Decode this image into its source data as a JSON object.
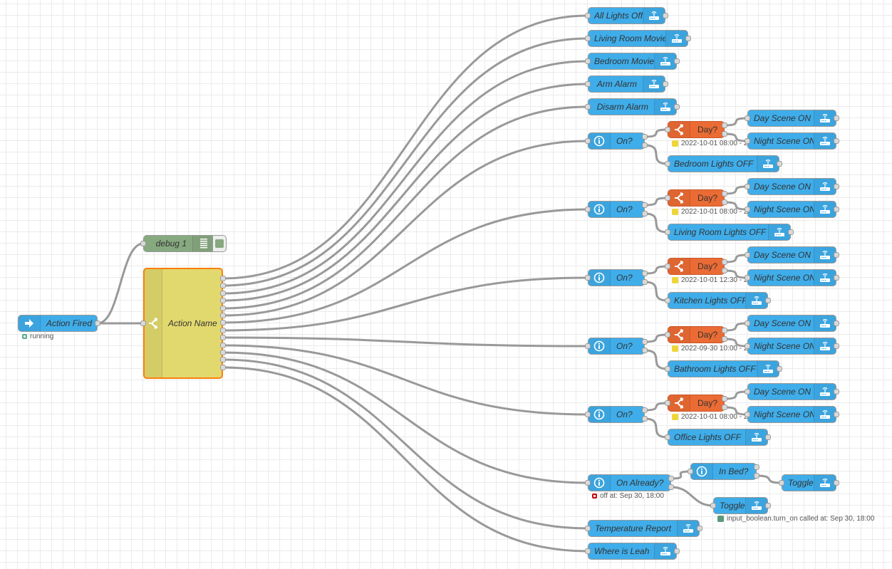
{
  "canvas": {
    "grid_color": "#ebebeb",
    "wire_color": "#999999"
  },
  "colors": {
    "ha_node": "#3fadea",
    "switch_node": "#eb6b34",
    "debug_node": "#87a980",
    "action_switch_node": "#e2d96e",
    "selected_border": "#ff7f0e"
  },
  "nodes": {
    "action_fired": {
      "label": "Action Fired",
      "icon": "arrow-right-icon",
      "status": "running"
    },
    "debug": {
      "label": "debug 1",
      "icon": "list-icon"
    },
    "action_name": {
      "label": "Action Name",
      "icon": "switch-icon",
      "outputs": 13
    },
    "all_lights_off": {
      "label": "All Lights Off",
      "icon": "router-icon"
    },
    "living_room_movie": {
      "label": "Living Room Movie",
      "icon": "router-icon"
    },
    "bedroom_movie": {
      "label": "Bedroom Movie",
      "icon": "router-icon"
    },
    "arm_alarm": {
      "label": "Arm Alarm",
      "icon": "router-icon"
    },
    "disarm_alarm": {
      "label": "Disarm Alarm",
      "icon": "router-icon"
    },
    "groups": [
      {
        "check": "On?",
        "switch": "Day?",
        "switch_status": "2022-10-01 08:00 - 2",
        "day": "Day Scene ON",
        "night": "Night Scene ON",
        "off": "Bedroom Lights OFF"
      },
      {
        "check": "On?",
        "switch": "Day?",
        "switch_status": "2022-10-01 08:00 - 2",
        "day": "Day Scene ON",
        "night": "Night Scene ON",
        "off": "Living Room Lights OFF"
      },
      {
        "check": "On?",
        "switch": "Day?",
        "switch_status": "2022-10-01 12:30 - 2",
        "day": "Day Scene ON",
        "night": "Night Scene ON",
        "off": "Kitchen Lights OFF"
      },
      {
        "check": "On?",
        "switch": "Day?",
        "switch_status": "2022-09-30 10:00 - 2",
        "day": "Day Scene ON",
        "night": "Night Scene ON",
        "off": "Bathroom Lights OFF"
      },
      {
        "check": "On?",
        "switch": "Day?",
        "switch_status": "2022-10-01 08:00 - 2",
        "day": "Day Scene ON",
        "night": "Night Scene ON",
        "off": "Office Lights OFF"
      }
    ],
    "on_already": {
      "label": "On Already?",
      "status": "off at: Sep 30, 18:00"
    },
    "in_bed": {
      "label": "In Bed?"
    },
    "toggle_top": {
      "label": "Toggle"
    },
    "toggle_bottom": {
      "label": "Toggle",
      "status": "input_boolean.turn_on called at: Sep 30, 18:00"
    },
    "temperature_report": {
      "label": "Temperature Report"
    },
    "where_is_leah": {
      "label": "Where is Leah"
    }
  }
}
